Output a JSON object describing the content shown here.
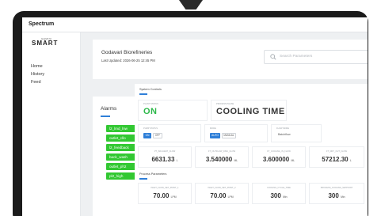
{
  "topbar": {
    "brand": "Spectrum"
  },
  "sidebar": {
    "logo_small": "GEMINI",
    "logo_main": "SMART",
    "items": [
      {
        "label": "Home"
      },
      {
        "label": "History"
      },
      {
        "label": "Feed"
      }
    ]
  },
  "plant": {
    "name": "Godavari Biorefineries",
    "last_updated": "Last Updated: 2026-06-25 12:45 PM"
  },
  "search": {
    "placeholder": "Search Parameters",
    "icon": "search-icon"
  },
  "alarms": {
    "title": "Alarms",
    "items": [
      "l2_lmd_lnw",
      "outlet_cllo",
      "l2_feedback",
      "back_wash",
      "outlet_ph2",
      "pl2_high"
    ],
    "color": "#32c832"
  },
  "system_controls": {
    "section_label": "System Controls",
    "status": {
      "label": "PLANT STATUS",
      "value": "ON",
      "color": "#2db84a"
    },
    "phase": {
      "label": "PROCESS PHASE",
      "value": "COOLING TIME"
    },
    "pump": {
      "label": "PUMP STATUS",
      "on": "ON",
      "off": "OFF",
      "selected": "ON"
    },
    "mode": {
      "label": "MODE",
      "auto": "AUTO",
      "manual": "MANUAL",
      "selected": "AUTO"
    },
    "flow_mode": {
      "label": "FLOW MODE",
      "value": "Batchflow"
    },
    "readings": [
      {
        "label": "PT_INFLUENT_FLOW",
        "value": "6631.33",
        "unit": "L"
      },
      {
        "label": "FT_OUTFLOW_DISC_FLOW",
        "value": "3.540000",
        "unit": "ML"
      },
      {
        "label": "FT_COOLING_IN_FLOW",
        "value": "3.600000",
        "unit": "ML"
      },
      {
        "label": "FT_DRY_OUT_FLOW",
        "value": "57212.30",
        "unit": "L"
      }
    ]
  },
  "process_parameters": {
    "section_label": "Process Parameters",
    "items": [
      {
        "label": "INLET_FLOW_SET_POINT_1",
        "value": "70.00",
        "unit": "LPM"
      },
      {
        "label": "INLET_FLOW_SET_POINT_2",
        "value": "70.00",
        "unit": "LPM"
      },
      {
        "label": "COOLING_CYCLE_TIME",
        "value": "300",
        "unit": "Min"
      },
      {
        "label": "PROCESS_COOLING_SETPOINT",
        "value": "300",
        "unit": "Min"
      }
    ]
  },
  "accent": "#2f7fd8"
}
